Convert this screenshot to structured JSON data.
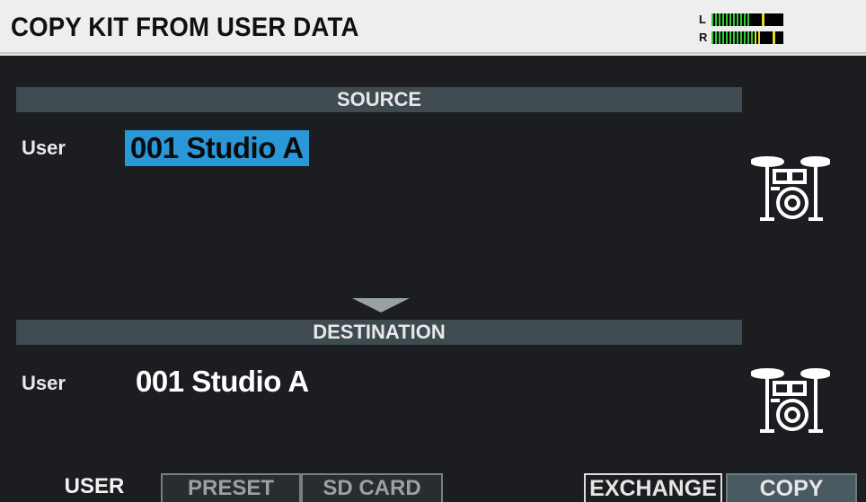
{
  "header": {
    "title": "COPY KIT FROM USER DATA",
    "meter": {
      "left_label": "L",
      "right_label": "R",
      "left_level": 0.55,
      "right_level": 0.72,
      "colors": {
        "green": "#2fc93a",
        "yellow": "#e8d82a",
        "orange": "#f08a1c"
      }
    }
  },
  "source": {
    "header": "SOURCE",
    "bank_label": "User",
    "kit_name": "001 Studio A",
    "icon": "drum-kit-icon"
  },
  "destination": {
    "header": "DESTINATION",
    "bank_label": "User",
    "kit_name": "001 Studio A",
    "icon": "drum-kit-icon"
  },
  "tabs": [
    {
      "label": "USER",
      "state": "active"
    },
    {
      "label": "PRESET",
      "state": "inactive"
    },
    {
      "label": "SD CARD",
      "state": "inactive"
    }
  ],
  "functions": [
    {
      "label": "EXCHANGE"
    },
    {
      "label": "COPY"
    }
  ],
  "colors": {
    "background": "#1b1d20",
    "title_bar": "#eeeeee",
    "section_bar": "#3f4b50",
    "selection": "#2a97d8"
  }
}
